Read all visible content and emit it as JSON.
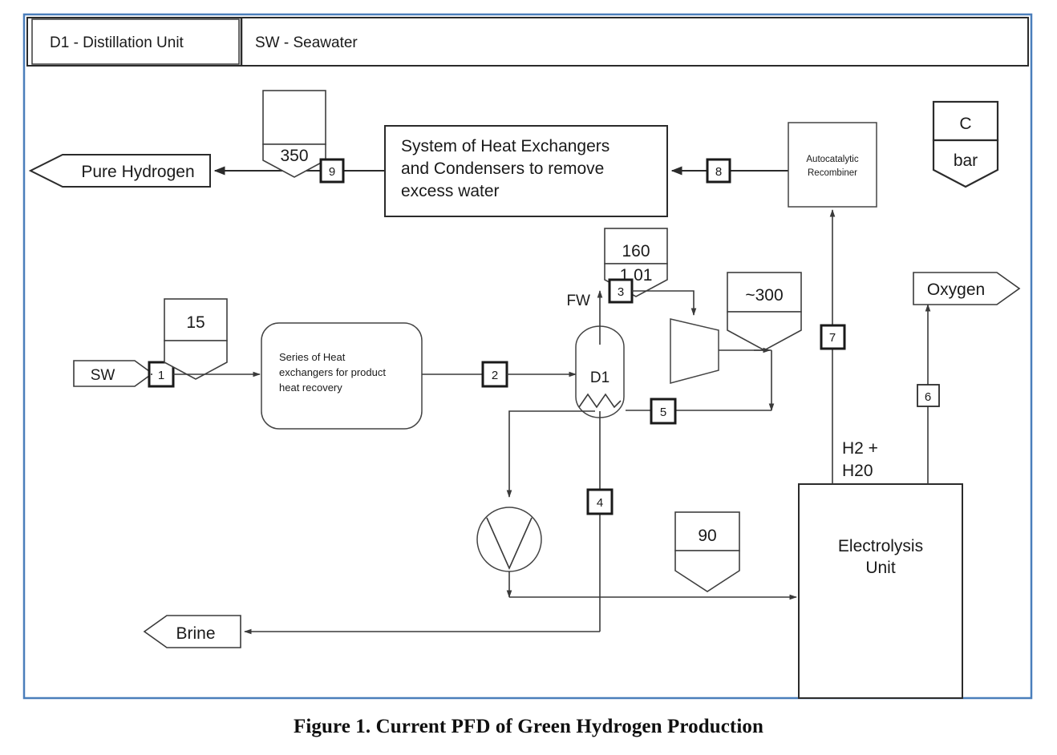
{
  "figure": {
    "caption": "Figure 1. Current PFD of Green Hydrogen Production"
  },
  "legend": {
    "items": [
      {
        "id": "d1",
        "label": "D1 - Distillation Unit"
      },
      {
        "id": "sw",
        "label": "SW - Seawater"
      }
    ],
    "key_flag": {
      "temperature_unit": "C",
      "pressure_unit": "bar"
    }
  },
  "units": [
    {
      "id": "heat-exchanger-network",
      "label": "Series of Heat exchangers for product heat recovery"
    },
    {
      "id": "condenser-system",
      "label": "System of Heat Exchangers and Condensers to remove excess water"
    },
    {
      "id": "autocatalytic-recombiner",
      "label": "Autocatalytic Recombiner"
    },
    {
      "id": "distillation-column",
      "label": "D1"
    },
    {
      "id": "electrolysis-unit",
      "label": "Electrolysis Unit"
    },
    {
      "id": "pump",
      "label": ""
    },
    {
      "id": "compressor",
      "label": ""
    }
  ],
  "unit_labels": {
    "heat_recovery_line1": "Series of Heat",
    "heat_recovery_line2": "exchangers for product",
    "heat_recovery_line3": "heat recovery",
    "condensers_line1": "System of Heat Exchangers",
    "condensers_line2": "and Condensers to remove",
    "condensers_line3": "excess water",
    "recombiner_line1": "Autocatalytic",
    "recombiner_line2": "Recombiner",
    "column": "D1",
    "electrolysis_line1": "Electrolysis",
    "electrolysis_line2": "Unit"
  },
  "streams": {
    "tags": [
      "1",
      "2",
      "3",
      "4",
      "5",
      "6",
      "7",
      "8",
      "9"
    ]
  },
  "stream_tags": {
    "s1": "1",
    "s2": "2",
    "s3": "3",
    "s4": "4",
    "s5": "5",
    "s6": "6",
    "s7": "7",
    "s8": "8",
    "s9": "9"
  },
  "io_nodes": {
    "seawater_in": "SW",
    "pure_hydrogen_out": "Pure Hydrogen",
    "oxygen_out": "Oxygen",
    "brine_out": "Brine"
  },
  "inline_labels": {
    "fresh_water": "FW",
    "recycle_line1": "H2 +",
    "recycle_line2": "H20"
  },
  "condition_flags": [
    {
      "id": "flag-stream1",
      "temperature": "15",
      "pressure": ""
    },
    {
      "id": "flag-stream9",
      "temperature": "",
      "pressure": "350"
    },
    {
      "id": "flag-stream3",
      "temperature": "160",
      "pressure": "1.01"
    },
    {
      "id": "flag-compressor-out",
      "temperature": "~300",
      "pressure": ""
    },
    {
      "id": "flag-electrolysis-feed",
      "temperature": "90",
      "pressure": ""
    }
  ],
  "flag_values": {
    "f15_top": "15",
    "f15_bot": "",
    "f350_top": "",
    "f350_bot": "350",
    "f160_top": "160",
    "f160_bot": "1.01",
    "f300_top": "~300",
    "f300_bot": "",
    "f90_top": "90",
    "f90_bot": "",
    "key_top": "C",
    "key_bot": "bar"
  },
  "colors": {
    "frame_blue": "#4a7ebb",
    "line_black": "#2b2b2b",
    "background": "#ffffff"
  }
}
